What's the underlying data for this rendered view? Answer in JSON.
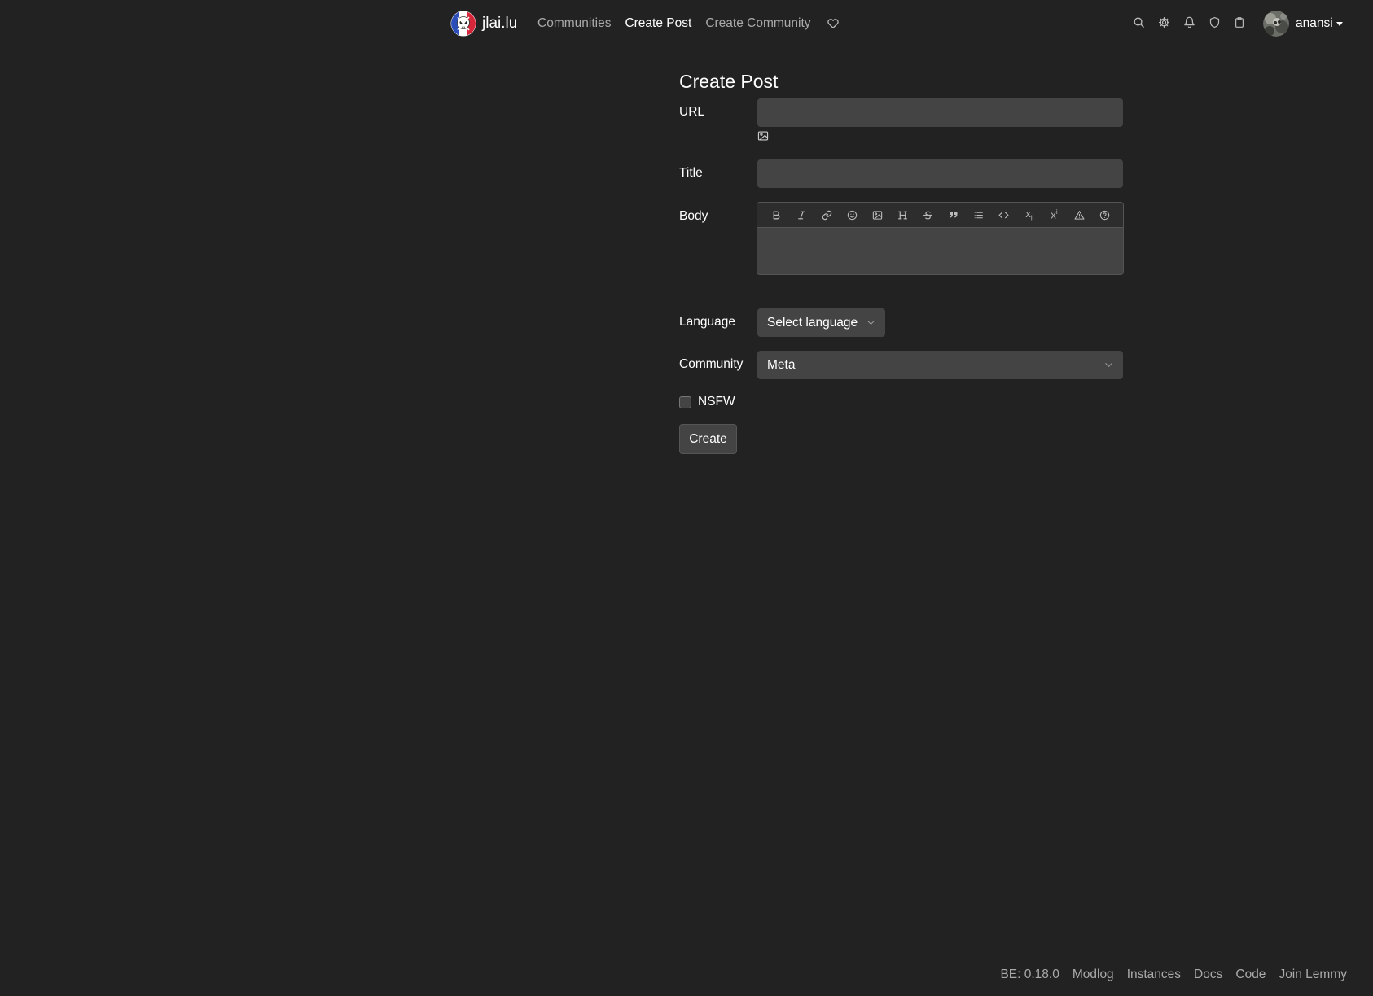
{
  "navbar": {
    "site_name": "jlai.lu",
    "links": {
      "communities": "Communities",
      "create_post": "Create Post",
      "create_community": "Create Community"
    },
    "icons": [
      "heart-icon",
      "search-icon",
      "gear-icon",
      "bell-icon",
      "shield-icon",
      "clipboard-icon"
    ],
    "user": {
      "name": "anansi"
    }
  },
  "form": {
    "title": "Create Post",
    "url_label": "URL",
    "url_value": "",
    "title_label": "Title",
    "title_value": "",
    "body_label": "Body",
    "body_value": "",
    "toolbar": {
      "subscript_label": "x",
      "subscript_sub": "i",
      "superscript_label": "x",
      "superscript_sup": "i"
    },
    "language_label": "Language",
    "language_value": "Select language",
    "community_label": "Community",
    "community_value": "Meta",
    "nsfw_label": "NSFW",
    "nsfw_checked": false,
    "create_label": "Create"
  },
  "footer": {
    "version": "BE: 0.18.0",
    "links": {
      "modlog": "Modlog",
      "instances": "Instances",
      "docs": "Docs",
      "code": "Code",
      "join": "Join Lemmy"
    }
  },
  "colors": {
    "background": "#222222",
    "input": "#444444",
    "toolbar": "#2d2d2d",
    "text": "#ffffff",
    "muted": "#aaaaaa"
  }
}
